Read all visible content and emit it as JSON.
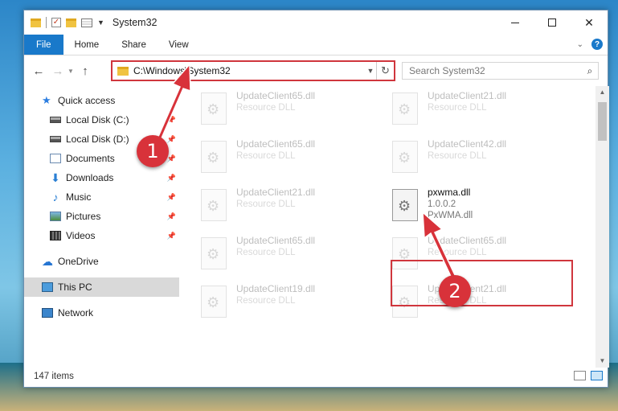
{
  "window": {
    "title": "System32"
  },
  "ribbon": {
    "tabs": [
      "File",
      "Home",
      "Share",
      "View"
    ]
  },
  "address": {
    "path": "C:\\Windows\\System32",
    "search_placeholder": "Search System32"
  },
  "nav": {
    "items": [
      {
        "label": "Quick access",
        "icon": "star-icon"
      },
      {
        "label": "Local Disk (C:)",
        "icon": "drive-icon"
      },
      {
        "label": "Local Disk (D:)",
        "icon": "drive-icon"
      },
      {
        "label": "Documents",
        "icon": "documents-icon"
      },
      {
        "label": "Downloads",
        "icon": "downloads-icon"
      },
      {
        "label": "Music",
        "icon": "music-icon"
      },
      {
        "label": "Pictures",
        "icon": "pictures-icon"
      },
      {
        "label": "Videos",
        "icon": "videos-icon"
      },
      {
        "label": "OneDrive",
        "icon": "cloud-icon"
      },
      {
        "label": "This PC",
        "icon": "computer-icon"
      },
      {
        "label": "Network",
        "icon": "network-icon"
      }
    ]
  },
  "files": [
    {
      "name": "UpdateClient65.dll",
      "desc": "Resource DLL"
    },
    {
      "name": "UpdateClient21.dll",
      "desc": "Resource DLL"
    },
    {
      "name": "UpdateClient65.dll",
      "desc": "Resource DLL"
    },
    {
      "name": "UpdateClient42.dll",
      "desc": "Resource DLL"
    },
    {
      "name": "UpdateClient21.dll",
      "desc": "Resource DLL"
    },
    {
      "name": "pxwma.dll",
      "desc": "1.0.0.2",
      "desc2": "PxWMA.dll"
    },
    {
      "name": "UpdateClient65.dll",
      "desc": "Resource DLL"
    },
    {
      "name": "UpdateClient65.dll",
      "desc": "Resource DLL"
    },
    {
      "name": "UpdateClient19.dll",
      "desc": "Resource DLL"
    },
    {
      "name": "UpdateClient21.dll",
      "desc": "Resource DLL"
    }
  ],
  "status": {
    "count": "147 items"
  },
  "annotations": {
    "step1": "1",
    "step2": "2"
  },
  "colors": {
    "accent": "#1979ca",
    "highlight": "#d0363d"
  }
}
